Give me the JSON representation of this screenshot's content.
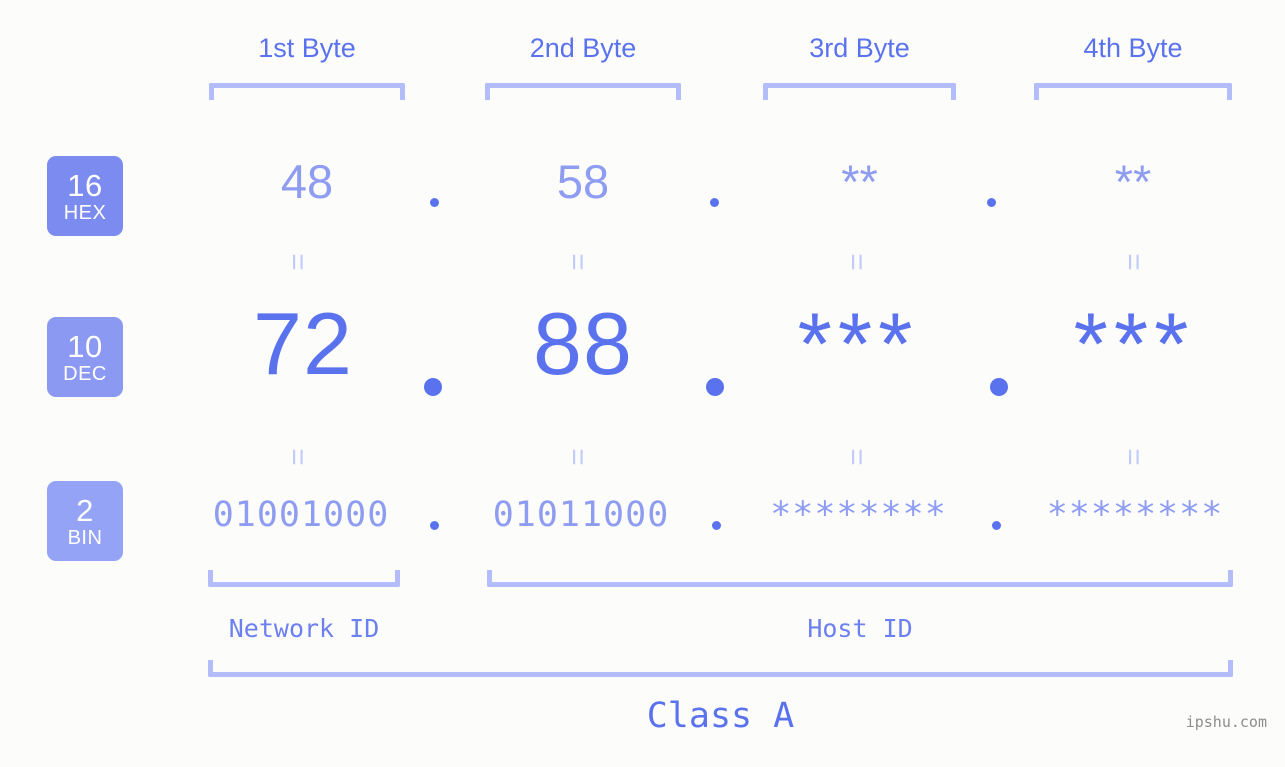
{
  "watermark": "ipshu.com",
  "columns": [
    {
      "header": "1st Byte"
    },
    {
      "header": "2nd Byte"
    },
    {
      "header": "3rd Byte"
    },
    {
      "header": "4th Byte"
    }
  ],
  "bases": [
    {
      "num": "16",
      "name": "HEX",
      "color": "#7b8bf0"
    },
    {
      "num": "10",
      "name": "DEC",
      "color": "#8b99f2"
    },
    {
      "num": "2",
      "name": "BIN",
      "color": "#94a3f6"
    }
  ],
  "rows": {
    "hex": {
      "values": [
        "48",
        "58",
        "**",
        "**"
      ],
      "separator": "."
    },
    "dec": {
      "values": [
        "72",
        "88",
        "***",
        "***"
      ],
      "separator": "."
    },
    "bin": {
      "values": [
        "01001000",
        "01011000",
        "********",
        "********"
      ],
      "separator": "."
    }
  },
  "equals": "=",
  "segments": {
    "network": "Network ID",
    "host": "Host ID"
  },
  "class": "Class A",
  "colors": {
    "background": "#fcfdfa",
    "accent": "#5b72ef",
    "accent_light": "#8e9cf2",
    "bracket": "#b4bdfb",
    "equals": "#c3cbfb",
    "watermark": "#8d8d8d"
  }
}
